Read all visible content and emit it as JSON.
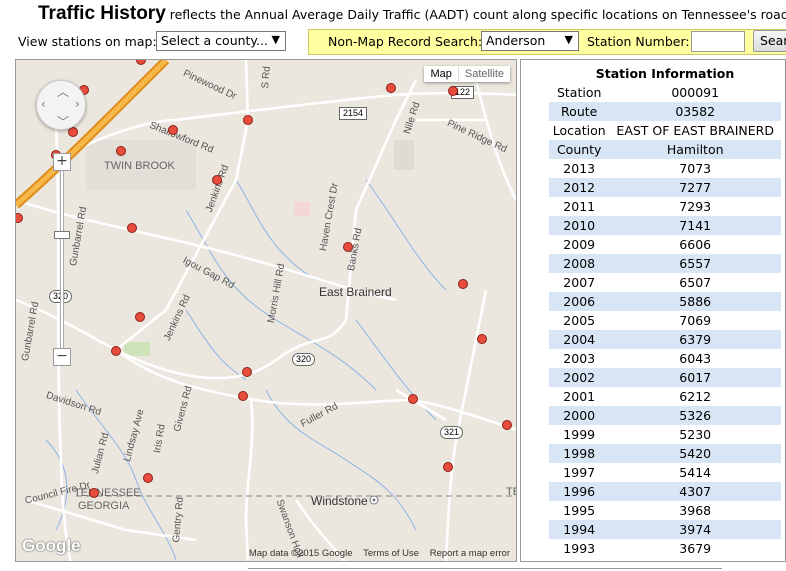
{
  "header": {
    "title": "Traffic History",
    "description": " reflects the Annual Average Daily Traffic (AADT) count along specific locations on Tennessee's road netw"
  },
  "controls": {
    "view_stations_label": "View stations on map:",
    "county_select_value": "Select a county...",
    "non_map_label": "Non-Map Record Search:",
    "county_search_value": "Anderson",
    "station_number_label": "Station Number:",
    "station_number_value": "",
    "search_button_label": "Sear"
  },
  "map": {
    "type_buttons": {
      "map": "Map",
      "satellite": "Satellite"
    },
    "labels": {
      "twin_brook": "TWIN BROOK",
      "east_brainerd": "East Brainerd",
      "windstone": "Windstone",
      "tennessee": "TENNESSEE",
      "georgia": "GEORGIA",
      "te": "TE",
      "shallowford": "Shallowford Rd",
      "jenkins_rd_top": "Jenkins Rd",
      "jenkins_rd_bottom": "Jenkins Rd",
      "igou_gap": "Igou Gap Rd",
      "morris_hill": "Morris Hill Rd",
      "gunbarrel_top": "Gunbarrel Rd",
      "gunbarrel_bottom": "Gunbarrel Rd",
      "davidson": "Davidson Rd",
      "lindsay": "Lindsay Ave",
      "julian": "Julian Rd",
      "givens": "Givens Rd",
      "iris": "Iris Rd",
      "gentry": "Gentry Rd",
      "swanson": "Swanson Holl",
      "fuller": "Fuller Rd",
      "pinewood": "Pinewood Dr",
      "nile": "Nile Rd",
      "pine_ridge": "Pine Ridge Rd",
      "haven_crest": "Haven Crest Dr",
      "banks": "Banks Rd",
      "council_fire": "Council Fire Dr",
      "s_rd": "S Rd"
    },
    "shields": {
      "route_2154": "2154",
      "route_122": "122",
      "route_320_left": "320",
      "route_320_mid": "320",
      "route_321": "321"
    },
    "attribution": {
      "data": "Map data ©2015 Google",
      "terms": "Terms of Use",
      "report": "Report a map error"
    },
    "logo": "Google",
    "colors": {
      "marker": "#e84c3d",
      "highway": "#f5a12c",
      "land": "#ebe7df",
      "water": "#6b9fe0"
    }
  },
  "station_info": {
    "title": "Station Information",
    "fields": [
      {
        "key": "Station",
        "value": "000091"
      },
      {
        "key": "Route",
        "value": "03582"
      },
      {
        "key": "Location",
        "value": "EAST OF EAST BRAINERD"
      },
      {
        "key": "County",
        "value": "Hamilton"
      }
    ],
    "history": [
      {
        "year": "2013",
        "aadt": "7073"
      },
      {
        "year": "2012",
        "aadt": "7277"
      },
      {
        "year": "2011",
        "aadt": "7293"
      },
      {
        "year": "2010",
        "aadt": "7141"
      },
      {
        "year": "2009",
        "aadt": "6606"
      },
      {
        "year": "2008",
        "aadt": "6557"
      },
      {
        "year": "2007",
        "aadt": "6507"
      },
      {
        "year": "2006",
        "aadt": "5886"
      },
      {
        "year": "2005",
        "aadt": "7069"
      },
      {
        "year": "2004",
        "aadt": "6379"
      },
      {
        "year": "2003",
        "aadt": "6043"
      },
      {
        "year": "2002",
        "aadt": "6017"
      },
      {
        "year": "2001",
        "aadt": "6212"
      },
      {
        "year": "2000",
        "aadt": "5326"
      },
      {
        "year": "1999",
        "aadt": "5230"
      },
      {
        "year": "1998",
        "aadt": "5420"
      },
      {
        "year": "1997",
        "aadt": "5414"
      },
      {
        "year": "1996",
        "aadt": "4307"
      },
      {
        "year": "1995",
        "aadt": "3968"
      },
      {
        "year": "1994",
        "aadt": "3974"
      },
      {
        "year": "1993",
        "aadt": "3679"
      }
    ]
  }
}
